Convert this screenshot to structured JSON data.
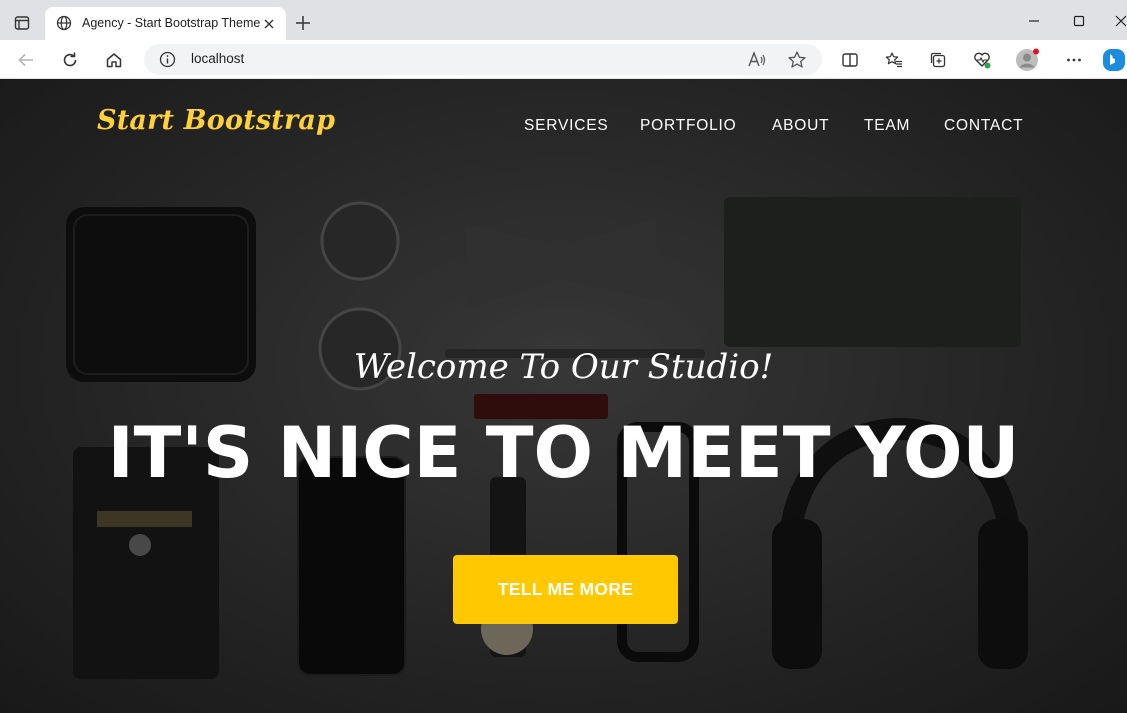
{
  "browser": {
    "tab_title": "Agency - Start Bootstrap Theme",
    "url": "localhost"
  },
  "site": {
    "brand": "Start Bootstrap",
    "nav": [
      "SERVICES",
      "PORTFOLIO",
      "ABOUT",
      "TEAM",
      "CONTACT"
    ],
    "hero": {
      "subheading": "Welcome To Our Studio!",
      "heading": "IT'S NICE TO MEET YOU",
      "button": "TELL ME MORE"
    }
  },
  "colors": {
    "brand_yellow": "#fed136",
    "button_yellow": "#ffc800"
  }
}
